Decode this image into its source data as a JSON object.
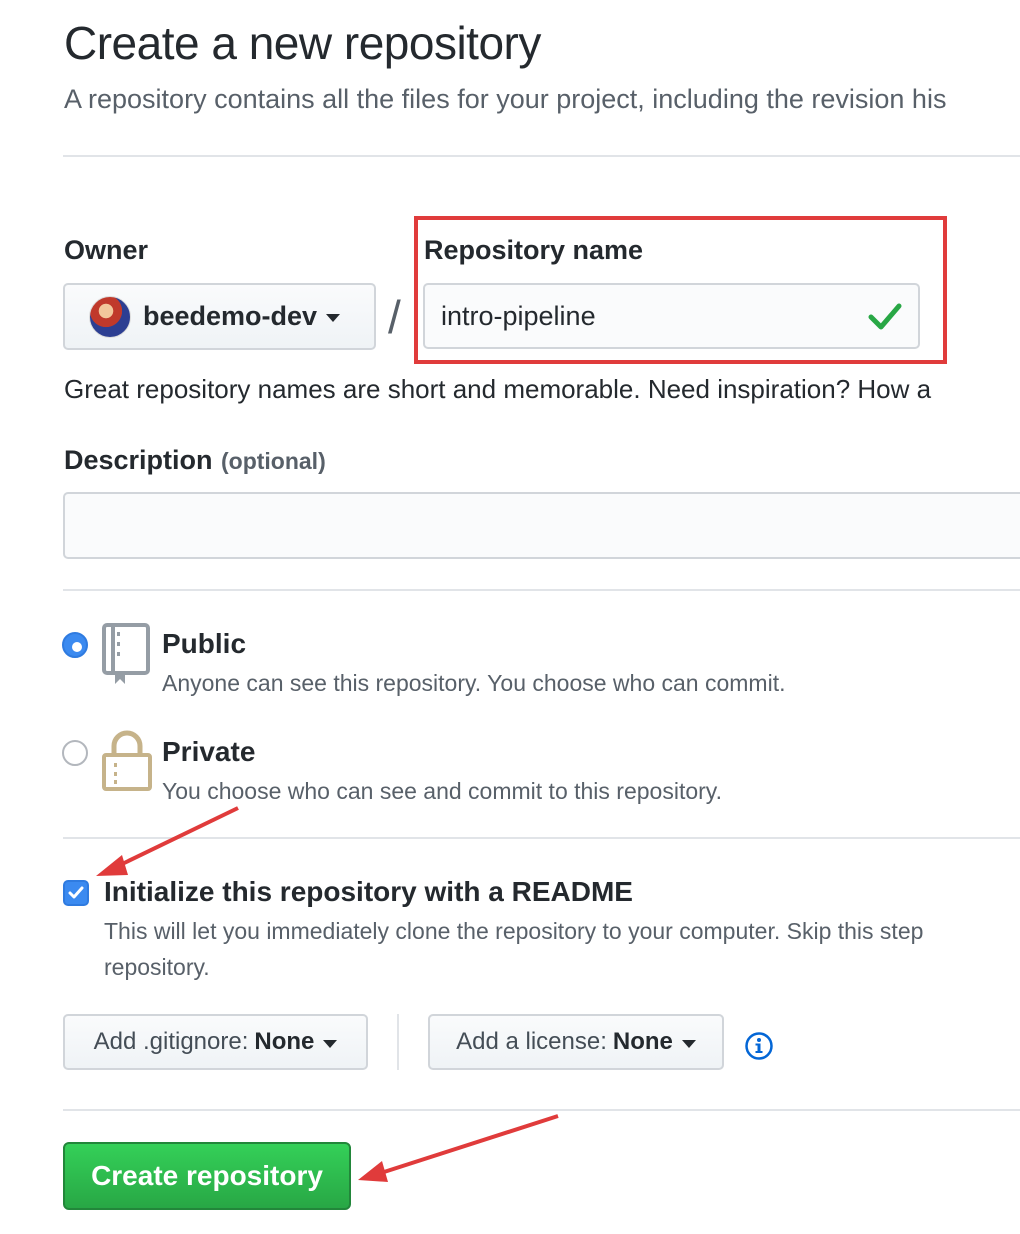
{
  "header": {
    "title": "Create a new repository",
    "subtitle": "A repository contains all the files for your project, including the revision his"
  },
  "owner": {
    "label": "Owner",
    "selected": "beedemo-dev"
  },
  "separator": "/",
  "repo_name": {
    "label": "Repository name",
    "value": "intro-pipeline",
    "valid": true
  },
  "name_hint": "Great repository names are short and memorable. Need inspiration? How a",
  "description": {
    "label": "Description",
    "optional": "(optional)",
    "value": ""
  },
  "visibility": {
    "public": {
      "title": "Public",
      "desc": "Anyone can see this repository. You choose who can commit.",
      "selected": true
    },
    "private": {
      "title": "Private",
      "desc": "You choose who can see and commit to this repository.",
      "selected": false
    }
  },
  "readme": {
    "title": "Initialize this repository with a README",
    "desc_line1": "This will let you immediately clone the repository to your computer. Skip this step",
    "desc_line2": "repository.",
    "checked": true
  },
  "gitignore": {
    "prefix": "Add .gitignore:",
    "value": "None"
  },
  "license": {
    "prefix": "Add a license:",
    "value": "None"
  },
  "submit": {
    "label": "Create repository"
  },
  "colors": {
    "accent_blue": "#3b8af0",
    "success_green": "#28a745",
    "annotation_red": "#e03b3b"
  }
}
